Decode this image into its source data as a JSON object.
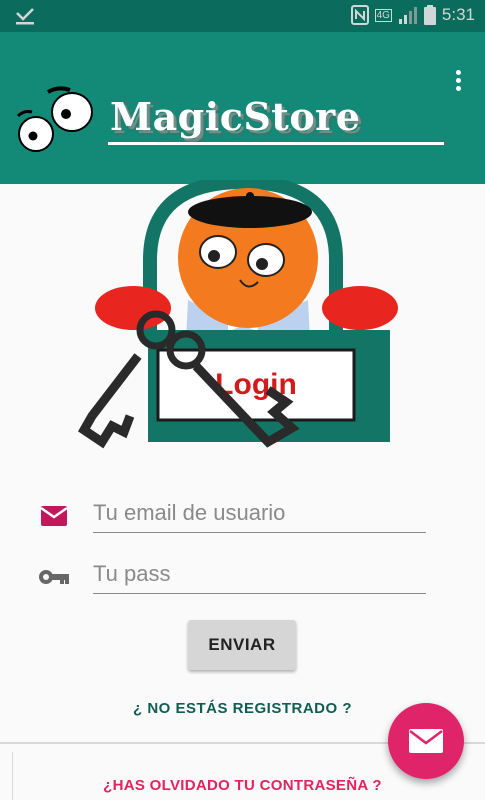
{
  "status_bar": {
    "time": "5:31",
    "network_label": "4G",
    "icons": [
      "download-done-icon",
      "nfc-icon",
      "signal-icon",
      "battery-icon"
    ]
  },
  "app_bar": {
    "title": "MagicStore",
    "overflow_icon": "more-vert-icon",
    "color": "#138a78"
  },
  "logo": {
    "label": "Login"
  },
  "form": {
    "email": {
      "icon": "mail-icon",
      "placeholder": "Tu email de usuario",
      "value": ""
    },
    "password": {
      "icon": "key-icon",
      "placeholder": "Tu pass",
      "value": ""
    },
    "submit_label": "ENVIAR"
  },
  "links": {
    "register": "¿ NO ESTÁS REGISTRADO ?",
    "forgot_password": "¿HAS OLVIDADO TU CONTRASEÑA ?"
  },
  "fab": {
    "icon": "mail-icon",
    "color": "#e0246a"
  },
  "colors": {
    "accent": "#e0246a",
    "dark_teal": "#0f5e54",
    "icon_pink": "#c2185b"
  }
}
